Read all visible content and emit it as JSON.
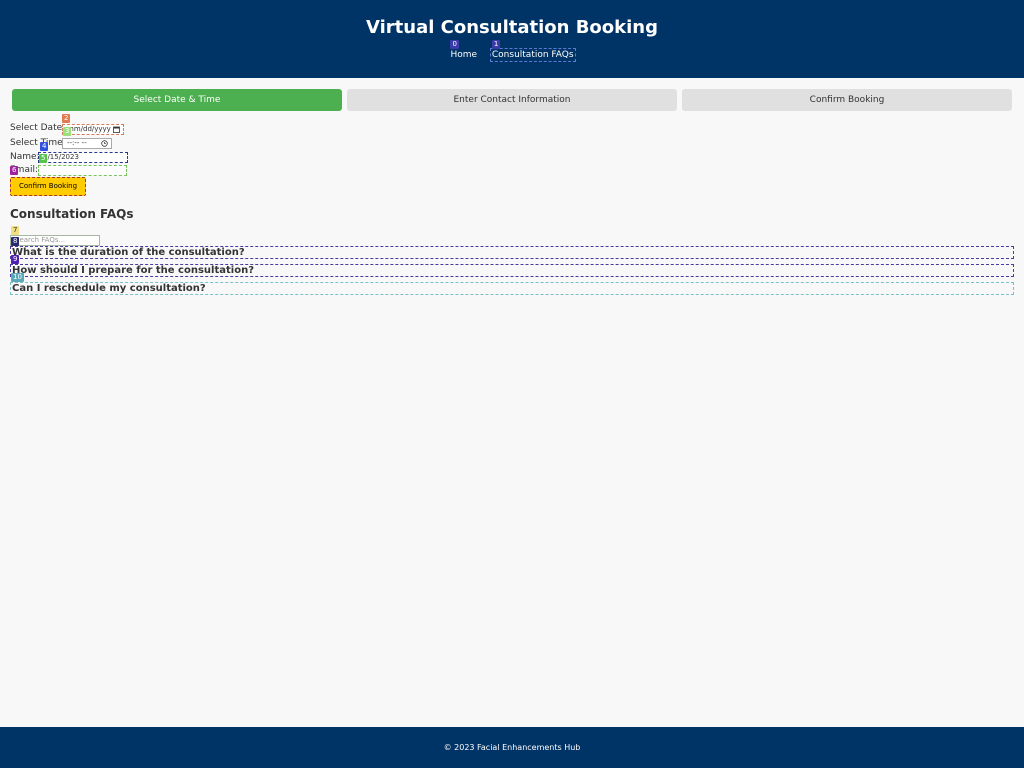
{
  "header": {
    "title": "Virtual Consultation Booking",
    "nav": [
      {
        "label": "Home",
        "badge": "0"
      },
      {
        "label": "Consultation FAQs",
        "badge": "1"
      }
    ]
  },
  "steps": [
    {
      "label": "Select Date & Time",
      "active": true
    },
    {
      "label": "Enter Contact Information",
      "active": false
    },
    {
      "label": "Confirm Booking",
      "active": false
    }
  ],
  "form": {
    "date_label": "Select Date:",
    "date_value": "mm/dd/yyyy",
    "date_badge": "2",
    "date_badge2": "3",
    "time_label": "Select Time:",
    "time_value": "--:-- --",
    "time_badge": "4",
    "name_label": "Name:",
    "name_value": "2/15/2023",
    "name_badge": "5",
    "email_label": "Email:",
    "email_value": "",
    "email_badge": "6",
    "confirm_label": "Confirm Booking"
  },
  "faqs": {
    "title": "Consultation FAQs",
    "search_placeholder": "Search FAQs...",
    "search_badge": "7",
    "items": [
      {
        "question": "What is the duration of the consultation?",
        "badge": "8"
      },
      {
        "question": "How should I prepare for the consultation?",
        "badge": "9"
      },
      {
        "question": "Can I reschedule my consultation?",
        "badge": "10"
      }
    ]
  },
  "footer": {
    "text": "© 2023 Facial Enhancements Hub"
  },
  "colors": {
    "header_bg": "#003366",
    "active_step": "#4caf50",
    "confirm_button": "#ffcc00"
  }
}
